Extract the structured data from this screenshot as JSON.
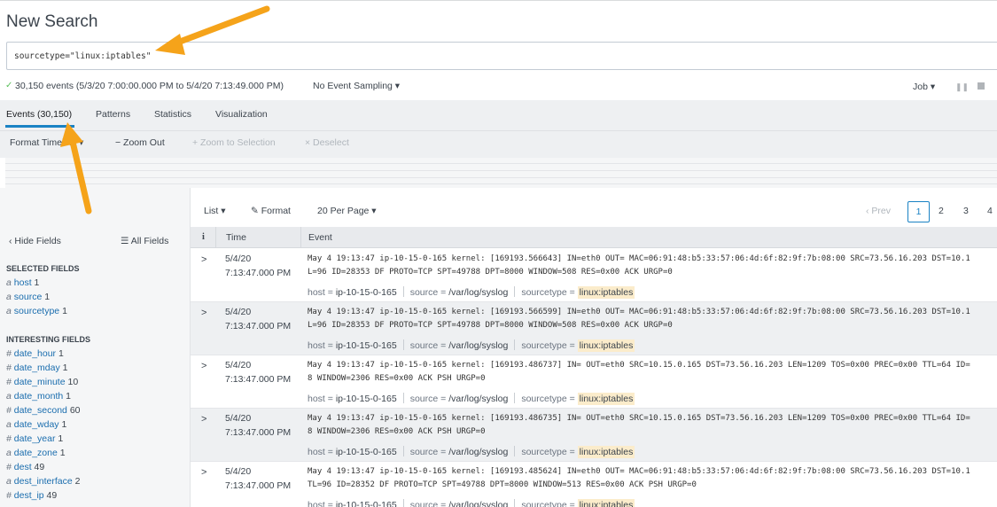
{
  "header": {
    "title": "New Search"
  },
  "search": {
    "query": "sourcetype=\"linux:iptables\""
  },
  "status": {
    "check": "✓",
    "events_text": "30,150 events (5/3/20 7:00:00.000 PM to 5/4/20 7:13:49.000 PM)",
    "sampling": "No Event Sampling ▾",
    "job": "Job ▾",
    "pause": "❚❚"
  },
  "tabs": [
    {
      "label": "Events (30,150)"
    },
    {
      "label": "Patterns"
    },
    {
      "label": "Statistics"
    },
    {
      "label": "Visualization"
    }
  ],
  "timeline_toolbar": {
    "format": "Format Timeline ▾",
    "zoom_out": "− Zoom Out",
    "zoom_sel": "+ Zoom to Selection",
    "deselect": "× Deselect"
  },
  "left_panel": {
    "hide_fields": "‹ Hide Fields",
    "all_fields": "☰ All Fields",
    "selected_heading": "SELECTED FIELDS",
    "selected": [
      {
        "type": "a",
        "name": "host",
        "count": "1"
      },
      {
        "type": "a",
        "name": "source",
        "count": "1"
      },
      {
        "type": "a",
        "name": "sourcetype",
        "count": "1"
      }
    ],
    "interesting_heading": "INTERESTING FIELDS",
    "interesting": [
      {
        "type": "#",
        "name": "date_hour",
        "count": "1"
      },
      {
        "type": "#",
        "name": "date_mday",
        "count": "1"
      },
      {
        "type": "#",
        "name": "date_minute",
        "count": "10"
      },
      {
        "type": "a",
        "name": "date_month",
        "count": "1"
      },
      {
        "type": "#",
        "name": "date_second",
        "count": "60"
      },
      {
        "type": "a",
        "name": "date_wday",
        "count": "1"
      },
      {
        "type": "#",
        "name": "date_year",
        "count": "1"
      },
      {
        "type": "a",
        "name": "date_zone",
        "count": "1"
      },
      {
        "type": "#",
        "name": "dest",
        "count": "49"
      },
      {
        "type": "a",
        "name": "dest_interface",
        "count": "2"
      },
      {
        "type": "#",
        "name": "dest_ip",
        "count": "49"
      }
    ]
  },
  "list_toolbar": {
    "list": "List ▾",
    "format": "✎ Format",
    "per_page": "20 Per Page ▾",
    "prev": "‹ Prev",
    "pages": [
      "1",
      "2",
      "3",
      "4"
    ]
  },
  "table": {
    "col_info": "i",
    "col_time": "Time",
    "col_event": "Event",
    "rows": [
      {
        "date": "5/4/20",
        "time": "7:13:47.000 PM",
        "line1": "May  4 19:13:47 ip-10-15-0-165 kernel: [169193.566643] IN=eth0 OUT= MAC=06:91:48:b5:33:57:06:4d:6f:82:9f:7b:08:00 SRC=73.56.16.203 DST=10.1",
        "line2": "L=96 ID=28353 DF PROTO=TCP SPT=49788 DPT=8000 WINDOW=508 RES=0x00 ACK URGP=0",
        "host": "ip-10-15-0-165",
        "source": "/var/log/syslog",
        "sourcetype": "linux:iptables"
      },
      {
        "date": "5/4/20",
        "time": "7:13:47.000 PM",
        "line1": "May  4 19:13:47 ip-10-15-0-165 kernel: [169193.566599] IN=eth0 OUT= MAC=06:91:48:b5:33:57:06:4d:6f:82:9f:7b:08:00 SRC=73.56.16.203 DST=10.1",
        "line2": "L=96 ID=28353 DF PROTO=TCP SPT=49788 DPT=8000 WINDOW=508 RES=0x00 ACK URGP=0",
        "host": "ip-10-15-0-165",
        "source": "/var/log/syslog",
        "sourcetype": "linux:iptables"
      },
      {
        "date": "5/4/20",
        "time": "7:13:47.000 PM",
        "line1": "May  4 19:13:47 ip-10-15-0-165 kernel: [169193.486737] IN= OUT=eth0 SRC=10.15.0.165 DST=73.56.16.203 LEN=1209 TOS=0x00 PREC=0x00 TTL=64 ID=",
        "line2": "8 WINDOW=2306 RES=0x00 ACK PSH URGP=0",
        "host": "ip-10-15-0-165",
        "source": "/var/log/syslog",
        "sourcetype": "linux:iptables"
      },
      {
        "date": "5/4/20",
        "time": "7:13:47.000 PM",
        "line1": "May  4 19:13:47 ip-10-15-0-165 kernel: [169193.486735] IN= OUT=eth0 SRC=10.15.0.165 DST=73.56.16.203 LEN=1209 TOS=0x00 PREC=0x00 TTL=64 ID=",
        "line2": "8 WINDOW=2306 RES=0x00 ACK PSH URGP=0",
        "host": "ip-10-15-0-165",
        "source": "/var/log/syslog",
        "sourcetype": "linux:iptables"
      },
      {
        "date": "5/4/20",
        "time": "7:13:47.000 PM",
        "line1": "May  4 19:13:47 ip-10-15-0-165 kernel: [169193.485624] IN=eth0 OUT= MAC=06:91:48:b5:33:57:06:4d:6f:82:9f:7b:08:00 SRC=73.56.16.203 DST=10.1",
        "line2": "TL=96 ID=28352 DF PROTO=TCP SPT=49788 DPT=8000 WINDOW=513 RES=0x00 ACK PSH URGP=0",
        "host": "ip-10-15-0-165",
        "source": "/var/log/syslog",
        "sourcetype": "linux:iptables"
      }
    ]
  },
  "meta_labels": {
    "host": "host = ",
    "source": "source = ",
    "sourcetype": "sourcetype = "
  },
  "colors": {
    "accent": "#1a82c4",
    "link": "#1a6dae",
    "arrow": "#f5a31a",
    "check": "#5cc05c",
    "highlight": "#fbeccb"
  }
}
